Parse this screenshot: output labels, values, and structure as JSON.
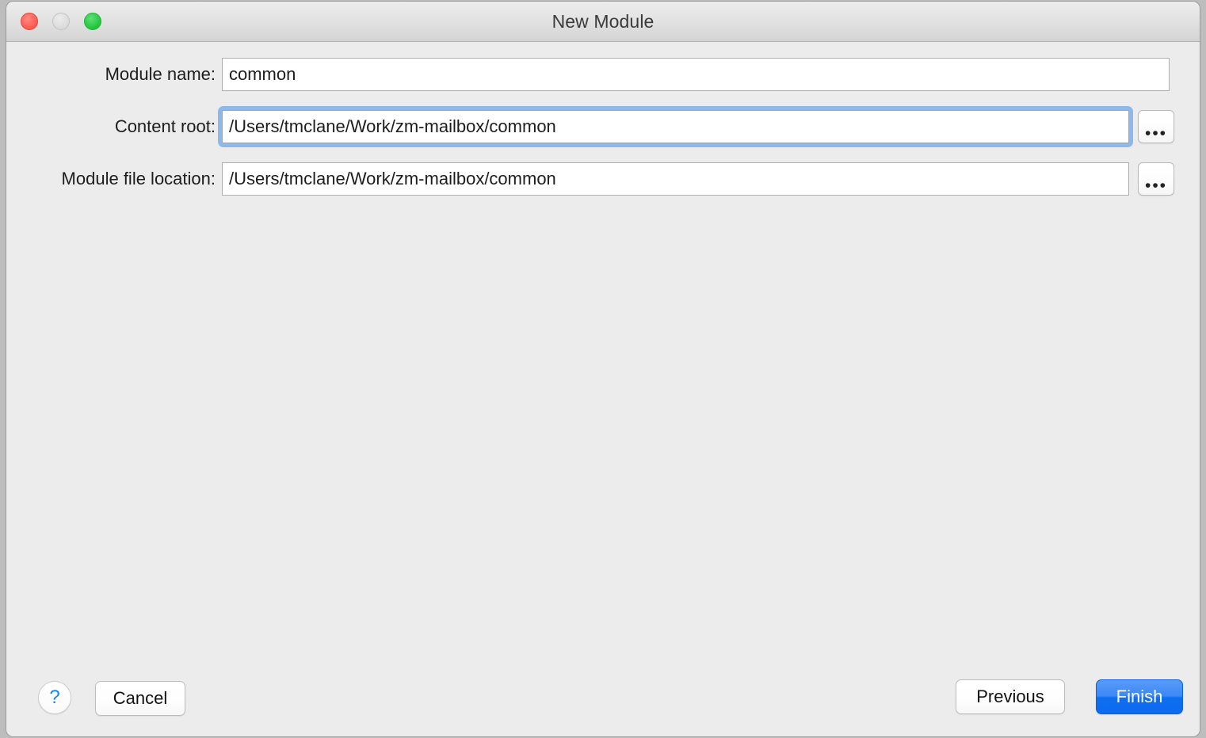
{
  "window": {
    "title": "New Module",
    "traffic_lights": [
      {
        "name": "close",
        "color": "#ff5f56"
      },
      {
        "name": "minimize",
        "color": "#dddddd"
      },
      {
        "name": "zoom",
        "color": "#27c93f"
      }
    ],
    "background": "#ececec"
  },
  "form": {
    "rows": [
      {
        "label": "Module name:",
        "value": "common",
        "placeholder": "",
        "focused": false,
        "has_browse": false
      },
      {
        "label": "Content root:",
        "value": "/Users/tmclane/Work/zm-mailbox/common",
        "placeholder": "",
        "focused": true,
        "has_browse": true,
        "browse_label": "•••"
      },
      {
        "label": "Module file location:",
        "value": "/Users/tmclane/Work/zm-mailbox/common",
        "placeholder": "",
        "focused": false,
        "has_browse": true,
        "browse_label": "•••"
      }
    ]
  },
  "footer": {
    "help_label": "?",
    "cancel_label": "Cancel",
    "previous_label": "Previous",
    "finish_label": "Finish",
    "accent_color": "#0f6ff0",
    "help_color": "#1a82f7"
  }
}
